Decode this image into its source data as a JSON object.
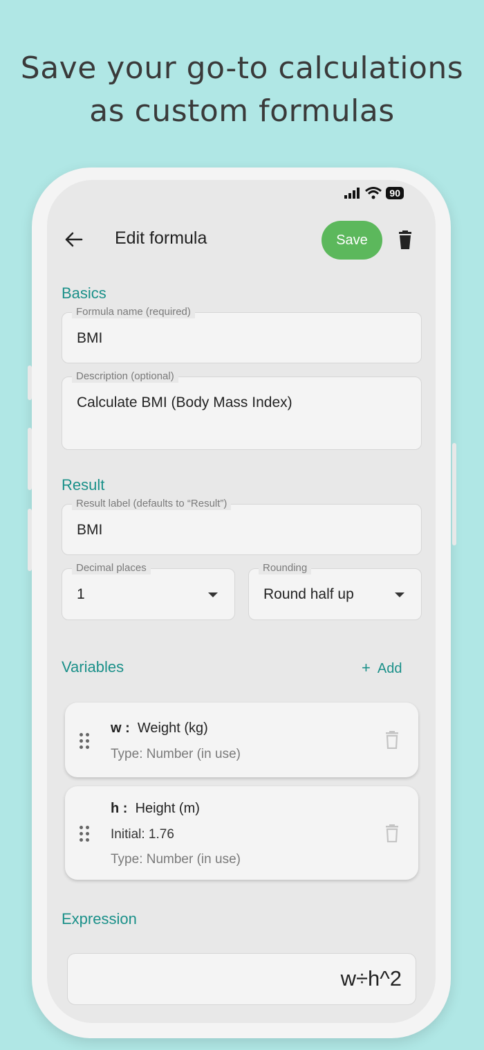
{
  "headline": {
    "line1": "Save your go-to calculations",
    "line2": "as custom formulas"
  },
  "status": {
    "battery": "90"
  },
  "appbar": {
    "title": "Edit formula",
    "save_label": "Save"
  },
  "basics": {
    "section": "Basics",
    "name_label": "Formula name (required)",
    "name_value": "BMI",
    "desc_label": "Description (optional)",
    "desc_value": "Calculate BMI (Body Mass Index)"
  },
  "result": {
    "section": "Result",
    "label_label": "Result label (defaults to “Result”)",
    "label_value": "BMI",
    "decimal_label": "Decimal places",
    "decimal_value": "1",
    "rounding_label": "Rounding",
    "rounding_value": "Round half up"
  },
  "variables": {
    "section": "Variables",
    "add_label": "Add",
    "items": [
      {
        "symbol": "w :",
        "name": "Weight (kg)",
        "type": "Type: Number (in use)"
      },
      {
        "symbol": "h :",
        "name": "Height (m)",
        "initial": "Initial: 1.76",
        "type": "Type: Number (in use)"
      }
    ]
  },
  "expression": {
    "section": "Expression",
    "value": "w÷h^2"
  }
}
